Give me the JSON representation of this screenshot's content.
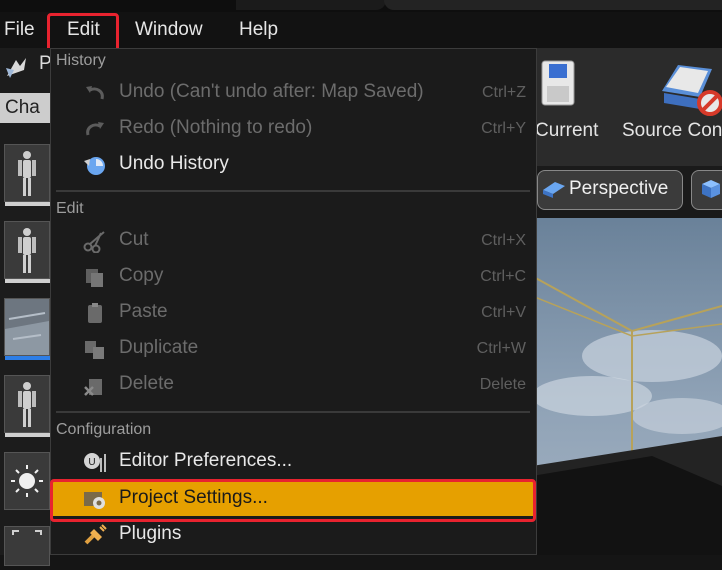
{
  "menubar": {
    "items": [
      "File",
      "Edit",
      "Window",
      "Help"
    ],
    "active": "Edit"
  },
  "left_panel": {
    "title_fragment": "P",
    "category_tab": "Cha"
  },
  "toolbar": {
    "save_current_label": "Current",
    "source_control_label": "Source Con"
  },
  "viewport": {
    "perspective_label": "Perspective"
  },
  "edit_menu": {
    "sections": {
      "history": "History",
      "edit": "Edit",
      "configuration": "Configuration"
    },
    "items": {
      "undo": {
        "label": "Undo (Can't undo after: Map Saved)",
        "shortcut": "Ctrl+Z",
        "icon": "undo-icon"
      },
      "redo": {
        "label": "Redo (Nothing to redo)",
        "shortcut": "Ctrl+Y",
        "icon": "redo-icon"
      },
      "undo_history": {
        "label": "Undo History",
        "icon": "undo-history-icon"
      },
      "cut": {
        "label": "Cut",
        "shortcut": "Ctrl+X",
        "icon": "scissors-icon"
      },
      "copy": {
        "label": "Copy",
        "shortcut": "Ctrl+C",
        "icon": "copy-icon"
      },
      "paste": {
        "label": "Paste",
        "shortcut": "Ctrl+V",
        "icon": "paste-icon"
      },
      "duplicate": {
        "label": "Duplicate",
        "shortcut": "Ctrl+W",
        "icon": "duplicate-icon"
      },
      "delete": {
        "label": "Delete",
        "shortcut": "Delete",
        "icon": "delete-icon"
      },
      "editor_preferences": {
        "label": "Editor Preferences...",
        "icon": "editor-preferences-icon"
      },
      "project_settings": {
        "label": "Project Settings...",
        "icon": "project-settings-icon"
      },
      "plugins": {
        "label": "Plugins",
        "icon": "plugins-icon"
      }
    }
  },
  "colors": {
    "selected_item_bg": "#e6a000",
    "callout_border": "#e8232f",
    "menu_bg": "#1b1b1b"
  }
}
